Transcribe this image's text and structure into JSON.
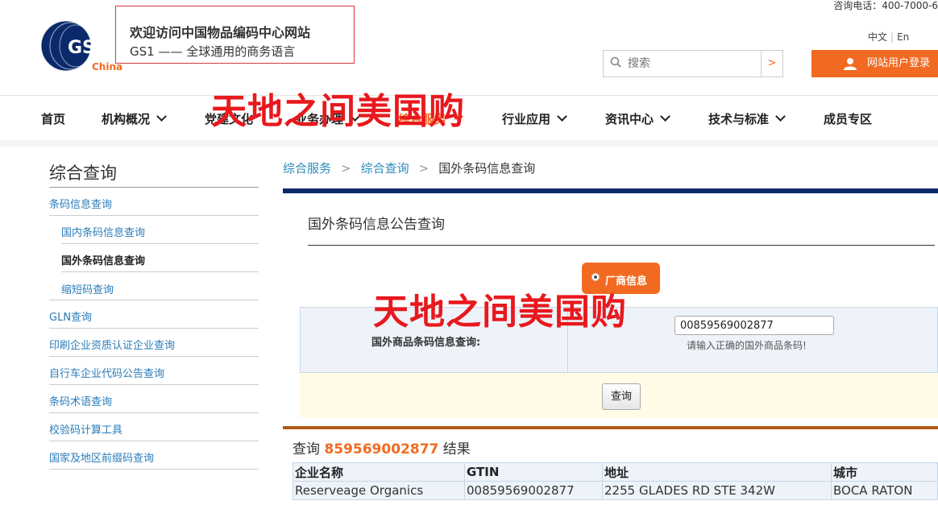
{
  "header": {
    "hotline": "咨询电话：400-7000-6",
    "logo_text": "GS1",
    "logo_sub": "China",
    "welcome_title": "欢迎访问中国物品编码中心网站",
    "welcome_sub": "GS1 —— 全球通用的商务语言",
    "lang_cn": "中文",
    "lang_sep": "|",
    "lang_en": "En",
    "search_placeholder": "搜索",
    "search_button": ">",
    "login_label": "网站用户登录"
  },
  "nav": {
    "items": [
      {
        "label": "首页"
      },
      {
        "label": "机构概况"
      },
      {
        "label": "党建文化"
      },
      {
        "label": "业务办理"
      },
      {
        "label": "综合服务"
      },
      {
        "label": "行业应用"
      },
      {
        "label": "资讯中心"
      },
      {
        "label": "技术与标准"
      },
      {
        "label": "成员专区"
      }
    ]
  },
  "watermark": "天地之间美国购",
  "sidebar": {
    "title": "综合查询",
    "items": [
      {
        "label": "条码信息查询"
      },
      {
        "label": "国内条码信息查询"
      },
      {
        "label": "国外条码信息查询"
      },
      {
        "label": "缩短码查询"
      },
      {
        "label": "GLN查询"
      },
      {
        "label": "印刷企业资质认证企业查询"
      },
      {
        "label": "自行车企业代码公告查询"
      },
      {
        "label": "条码术语查询"
      },
      {
        "label": "校验码计算工具"
      },
      {
        "label": "国家及地区前缀码查询"
      }
    ]
  },
  "breadcrumb": {
    "level1": "综合服务",
    "level2": "综合查询",
    "current": "国外条码信息查询",
    "sep": ">"
  },
  "main": {
    "title": "国外条码信息公告查询",
    "radio_label": "厂商信息",
    "form_label": "国外商品条码信息查询:",
    "input_value": "00859569002877",
    "hint": "请输入正确的国外商品条码!",
    "query_button": "查询"
  },
  "result": {
    "prefix": "查询",
    "code": "859569002877",
    "suffix": "结果",
    "columns": [
      "企业名称",
      "GTIN",
      "地址",
      "城市"
    ],
    "rows": [
      [
        "Reserveage Organics",
        "00859569002877",
        "2255 GLADES RD STE 342W",
        "BOCA RATON"
      ]
    ]
  },
  "colors": {
    "accent": "#f26a21",
    "link": "#2a7cb8",
    "navy": "#0a2a6b",
    "watermark": "#e8191e"
  }
}
